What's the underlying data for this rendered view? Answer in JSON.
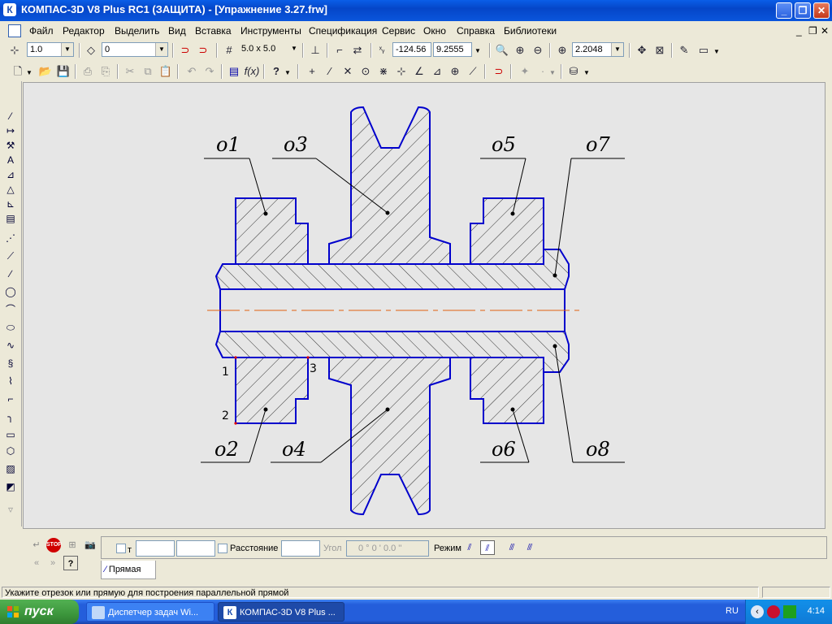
{
  "window": {
    "title": "КОМПАС-3D V8 Plus RC1 (ЗАЩИТА) - [Упражнение 3.27.frw]",
    "app_icon": "kompas-logo-icon",
    "controls": {
      "minimize": "_",
      "maximize": "❐",
      "close": "✕"
    }
  },
  "menu": {
    "items": [
      "Файл",
      "Редактор",
      "Выделить",
      "Вид",
      "Вставка",
      "Инструменты",
      "Спецификация",
      "Сервис",
      "Окно",
      "Справка",
      "Библиотеки"
    ],
    "mdi_controls": [
      "_",
      "❐",
      "✕"
    ]
  },
  "toolbar1": {
    "step_value": "1.0",
    "layer_value": "0",
    "grid_value": "5.0 x 5.0",
    "coord_x": "-124.56",
    "coord_y": "9.2555",
    "zoom_value": "2.2048"
  },
  "drawing": {
    "labels": [
      "о1",
      "о2",
      "о3",
      "о4",
      "о5",
      "о6",
      "о7",
      "о8"
    ],
    "point_numbers": [
      "1",
      "2",
      "3"
    ],
    "colors": {
      "outline": "#0000cc",
      "hatch": "#000000",
      "axis": "#e06010",
      "background": "#e6e6e6"
    }
  },
  "properties": {
    "t_label": "т",
    "distance_label": "Расстояние",
    "angle_label": "Угол",
    "angle_value": "0 ° 0 '   0.0 ''",
    "mode_label": "Режим",
    "tab_label": "Прямая"
  },
  "status": {
    "message": "Укажите отрезок или прямую для построения параллельной прямой"
  },
  "taskbar": {
    "start_label": "пуск",
    "tasks": [
      "Диспетчер задач Wi...",
      "КОМПАС-3D V8 Plus ..."
    ],
    "lang": "RU",
    "clock": "4:14"
  }
}
